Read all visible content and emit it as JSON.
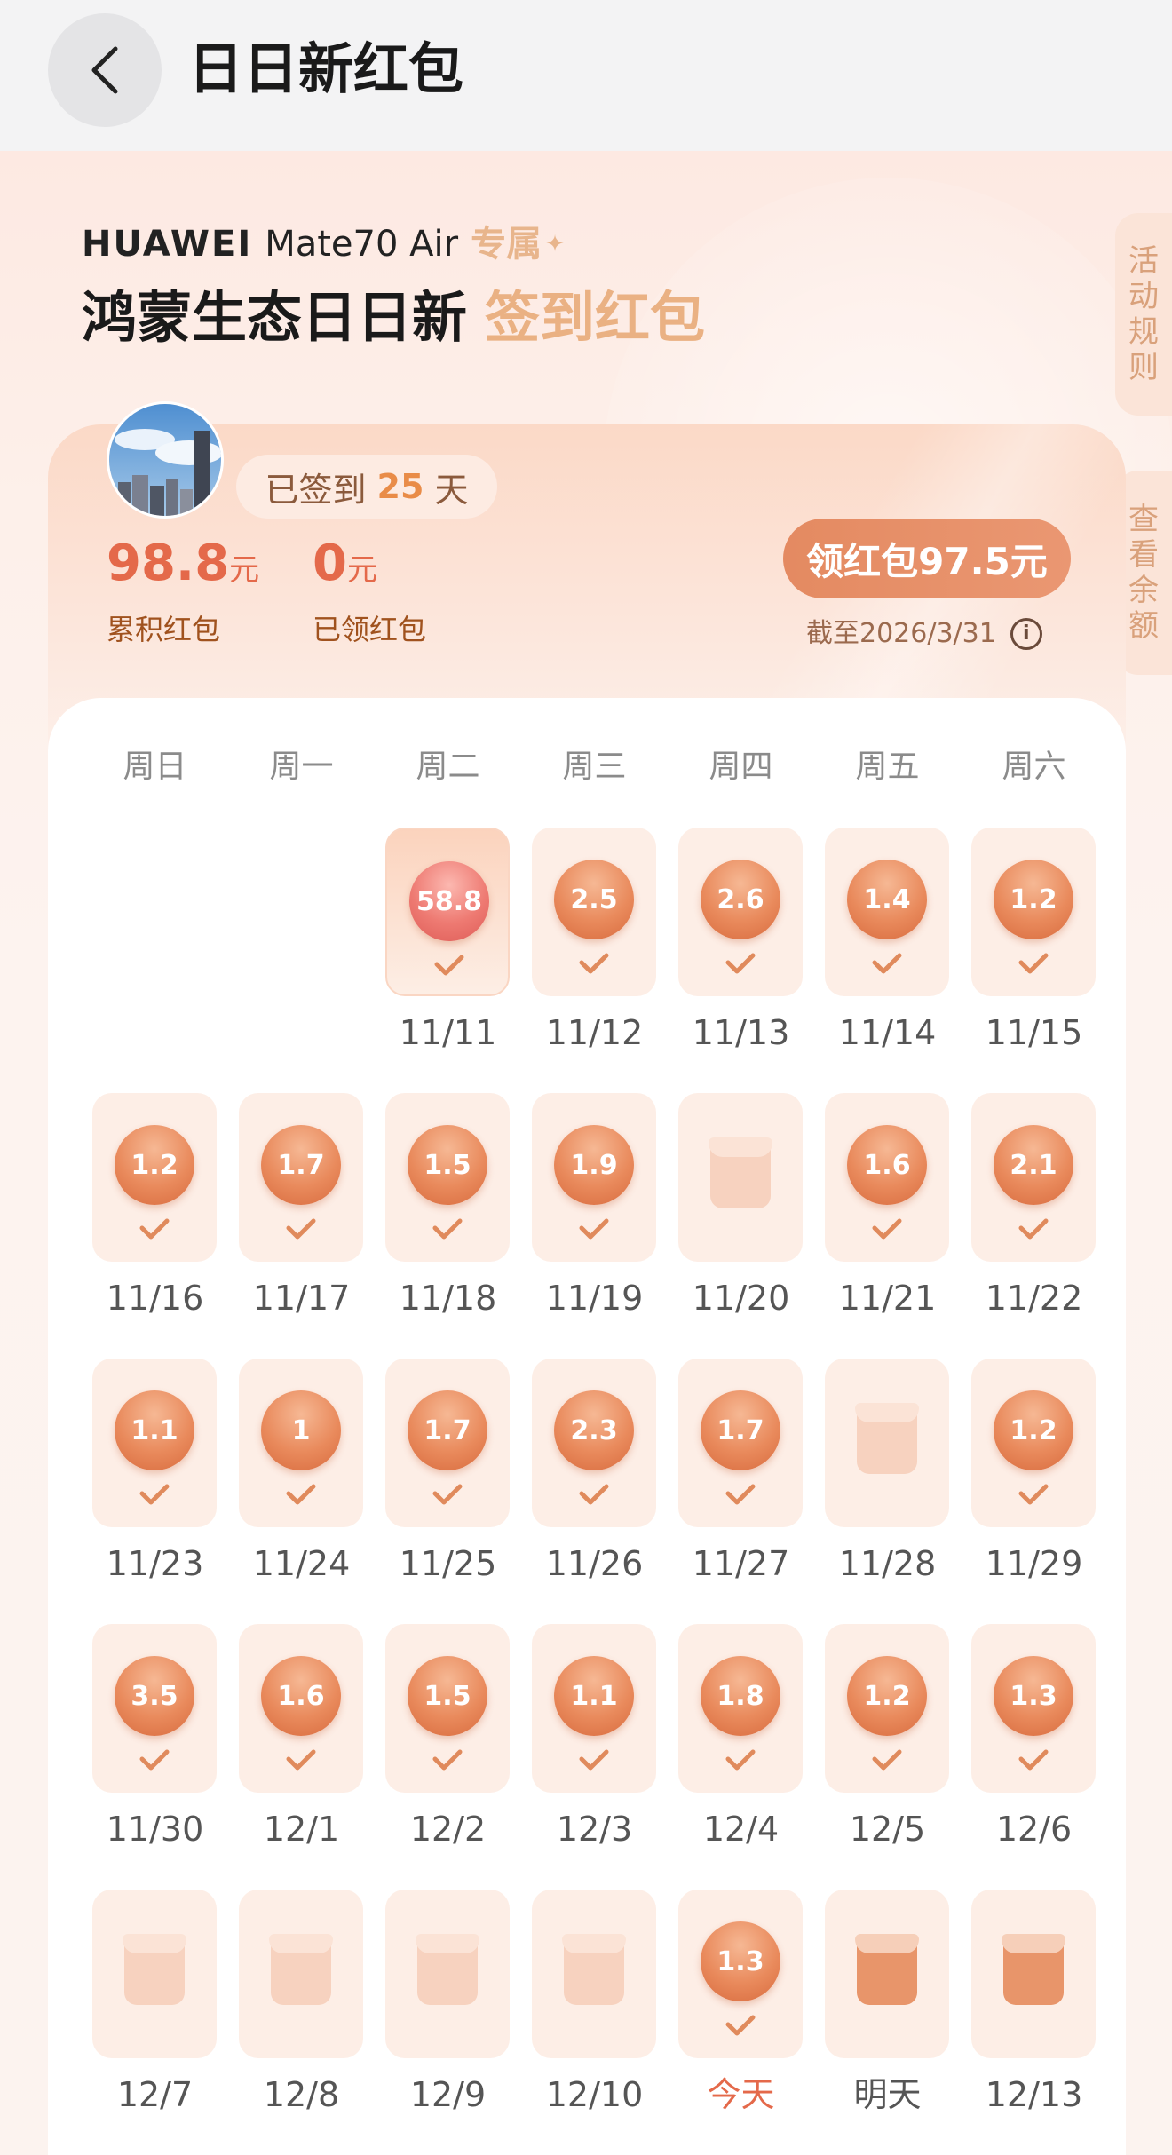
{
  "header": {
    "title": "日日新红包",
    "back_icon": "chevron-left-icon"
  },
  "hero": {
    "brand": "HUAWEI",
    "model": "Mate70 Air",
    "tag": "专属",
    "headline_main": "鸿蒙生态日日新",
    "headline_accent": "签到红包"
  },
  "side_tabs": {
    "rules": [
      "活",
      "动",
      "规",
      "则"
    ],
    "balance": [
      "查",
      "看",
      "余",
      "额"
    ]
  },
  "summary": {
    "signed_prefix": "已签到",
    "signed_days": "25",
    "signed_suffix": "天",
    "total_value": "98.8",
    "total_unit": "元",
    "total_label": "累积红包",
    "claimed_value": "0",
    "claimed_unit": "元",
    "claimed_label": "已领红包",
    "claim_button": "领红包97.5元",
    "deadline": "截至2026/3/31"
  },
  "calendar": {
    "weekdays": [
      "周日",
      "周一",
      "周二",
      "周三",
      "周四",
      "周五",
      "周六"
    ],
    "days": [
      {
        "date": "11/11",
        "col": 2,
        "row": 0,
        "amount": "58.8",
        "state": "big"
      },
      {
        "date": "11/12",
        "col": 3,
        "row": 0,
        "amount": "2.5",
        "state": "claimed"
      },
      {
        "date": "11/13",
        "col": 4,
        "row": 0,
        "amount": "2.6",
        "state": "claimed"
      },
      {
        "date": "11/14",
        "col": 5,
        "row": 0,
        "amount": "1.4",
        "state": "claimed"
      },
      {
        "date": "11/15",
        "col": 6,
        "row": 0,
        "amount": "1.2",
        "state": "claimed"
      },
      {
        "date": "11/16",
        "col": 0,
        "row": 1,
        "amount": "1.2",
        "state": "claimed"
      },
      {
        "date": "11/17",
        "col": 1,
        "row": 1,
        "amount": "1.7",
        "state": "claimed"
      },
      {
        "date": "11/18",
        "col": 2,
        "row": 1,
        "amount": "1.5",
        "state": "claimed"
      },
      {
        "date": "11/19",
        "col": 3,
        "row": 1,
        "amount": "1.9",
        "state": "claimed"
      },
      {
        "date": "11/20",
        "col": 4,
        "row": 1,
        "amount": "",
        "state": "missed"
      },
      {
        "date": "11/21",
        "col": 5,
        "row": 1,
        "amount": "1.6",
        "state": "claimed"
      },
      {
        "date": "11/22",
        "col": 6,
        "row": 1,
        "amount": "2.1",
        "state": "claimed"
      },
      {
        "date": "11/23",
        "col": 0,
        "row": 2,
        "amount": "1.1",
        "state": "claimed"
      },
      {
        "date": "11/24",
        "col": 1,
        "row": 2,
        "amount": "1",
        "state": "claimed"
      },
      {
        "date": "11/25",
        "col": 2,
        "row": 2,
        "amount": "1.7",
        "state": "claimed"
      },
      {
        "date": "11/26",
        "col": 3,
        "row": 2,
        "amount": "2.3",
        "state": "claimed"
      },
      {
        "date": "11/27",
        "col": 4,
        "row": 2,
        "amount": "1.7",
        "state": "claimed"
      },
      {
        "date": "11/28",
        "col": 5,
        "row": 2,
        "amount": "",
        "state": "missed"
      },
      {
        "date": "11/29",
        "col": 6,
        "row": 2,
        "amount": "1.2",
        "state": "claimed"
      },
      {
        "date": "11/30",
        "col": 0,
        "row": 3,
        "amount": "3.5",
        "state": "claimed"
      },
      {
        "date": "12/1",
        "col": 1,
        "row": 3,
        "amount": "1.6",
        "state": "claimed"
      },
      {
        "date": "12/2",
        "col": 2,
        "row": 3,
        "amount": "1.5",
        "state": "claimed"
      },
      {
        "date": "12/3",
        "col": 3,
        "row": 3,
        "amount": "1.1",
        "state": "claimed"
      },
      {
        "date": "12/4",
        "col": 4,
        "row": 3,
        "amount": "1.8",
        "state": "claimed"
      },
      {
        "date": "12/5",
        "col": 5,
        "row": 3,
        "amount": "1.2",
        "state": "claimed"
      },
      {
        "date": "12/6",
        "col": 6,
        "row": 3,
        "amount": "1.3",
        "state": "claimed"
      },
      {
        "date": "12/7",
        "col": 0,
        "row": 4,
        "amount": "",
        "state": "missed"
      },
      {
        "date": "12/8",
        "col": 1,
        "row": 4,
        "amount": "",
        "state": "missed"
      },
      {
        "date": "12/9",
        "col": 2,
        "row": 4,
        "amount": "",
        "state": "missed"
      },
      {
        "date": "12/10",
        "col": 3,
        "row": 4,
        "amount": "",
        "state": "missed"
      },
      {
        "date": "今天",
        "col": 4,
        "row": 4,
        "amount": "1.3",
        "state": "today"
      },
      {
        "date": "明天",
        "col": 5,
        "row": 4,
        "amount": "",
        "state": "future"
      },
      {
        "date": "12/13",
        "col": 6,
        "row": 4,
        "amount": "",
        "state": "future"
      }
    ]
  },
  "colors": {
    "accent": "#e4694a",
    "coin": "#e98a5c",
    "card_bg": "#fdeee6",
    "headline_accent": "#eab183"
  }
}
